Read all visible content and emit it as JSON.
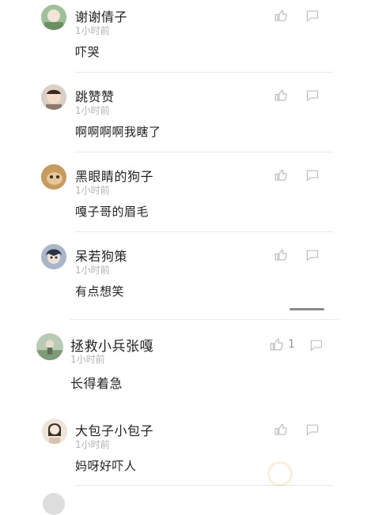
{
  "comments": [
    {
      "name": "谢谢倩子",
      "time": "1小时前",
      "text": "吓哭",
      "avatar_color": "#8fb38c"
    },
    {
      "name": "跳赞赞",
      "time": "1小时前",
      "text": "啊啊啊啊我瞎了",
      "avatar_color": "#c8b8a8"
    },
    {
      "name": "黑眼睛的狗子",
      "time": "1小时前",
      "text": "嘎子哥的眉毛",
      "avatar_color": "#b38a52"
    },
    {
      "name": "呆若狗策",
      "time": "1小时前",
      "text": "有点想笑",
      "avatar_color": "#7c8fa8"
    },
    {
      "name": "拯救小兵张嘎",
      "time": "1小时前",
      "text": "长得着急",
      "avatar_color": "#9cb39a",
      "likes": "1"
    },
    {
      "name": "大包子小包子",
      "time": "1小时前",
      "text": "妈呀好吓人",
      "avatar_color": "#e6d3c2"
    }
  ],
  "icons": {
    "like": "thumbs-up-icon",
    "reply": "comment-bubble-icon"
  },
  "colors": {
    "text": "#222222",
    "muted": "#b3b3b3",
    "icon": "#bdbdbd",
    "divider": "#e9e9e9"
  }
}
